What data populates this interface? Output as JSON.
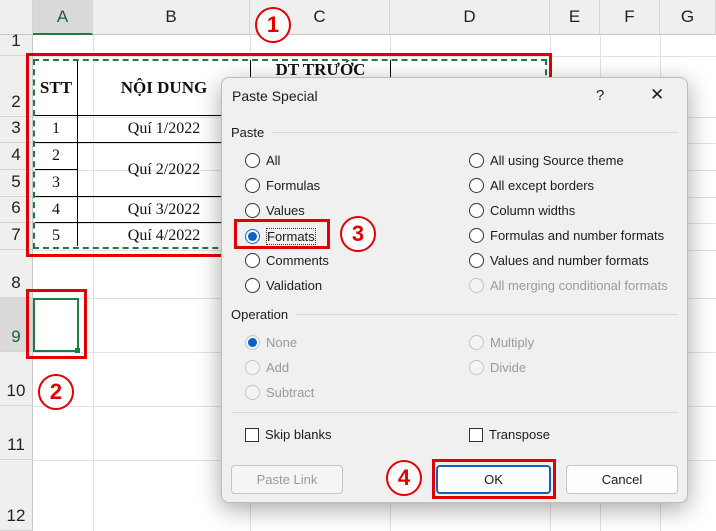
{
  "sheet": {
    "columns": [
      "A",
      "B",
      "C",
      "D",
      "E",
      "F",
      "G"
    ],
    "rows": [
      "1",
      "2",
      "3",
      "4",
      "5",
      "6",
      "7",
      "8",
      "9",
      "10",
      "11",
      "12"
    ],
    "table": {
      "headers": [
        "STT",
        "NỘI DUNG",
        "DT TRƯỚC"
      ],
      "stt": [
        "1",
        "2",
        "3",
        "4",
        "5"
      ],
      "content": [
        "Quí 1/2022",
        "Quí 2/2022",
        "Quí 3/2022",
        "Quí 4/2022"
      ]
    }
  },
  "dialog": {
    "title": "Paste Special",
    "help": "?",
    "close": "✕",
    "paste_group": "Paste",
    "paste_left": [
      {
        "label": "All",
        "checked": false
      },
      {
        "label": "Formulas",
        "checked": false
      },
      {
        "label": "Values",
        "checked": false
      },
      {
        "label": "Formats",
        "checked": true
      },
      {
        "label": "Comments",
        "checked": false
      },
      {
        "label": "Validation",
        "checked": false
      }
    ],
    "paste_right": [
      {
        "label": "All using Source theme",
        "disabled": false
      },
      {
        "label": "All except borders",
        "disabled": false
      },
      {
        "label": "Column widths",
        "disabled": false
      },
      {
        "label": "Formulas and number formats",
        "disabled": false
      },
      {
        "label": "Values and number formats",
        "disabled": false
      },
      {
        "label": "All merging conditional formats",
        "disabled": true
      }
    ],
    "operation_group": "Operation",
    "operation_left": [
      "None",
      "Add",
      "Subtract"
    ],
    "operation_right": [
      "Multiply",
      "Divide"
    ],
    "skip_blanks": "Skip blanks",
    "transpose": "Transpose",
    "paste_link": "Paste Link",
    "ok": "OK",
    "cancel": "Cancel"
  },
  "annotations": [
    "1",
    "2",
    "3",
    "4"
  ],
  "colors": {
    "annotation_red": "#e00000",
    "accent_blue": "#0b62c4",
    "excel_green": "#1f7a45"
  }
}
